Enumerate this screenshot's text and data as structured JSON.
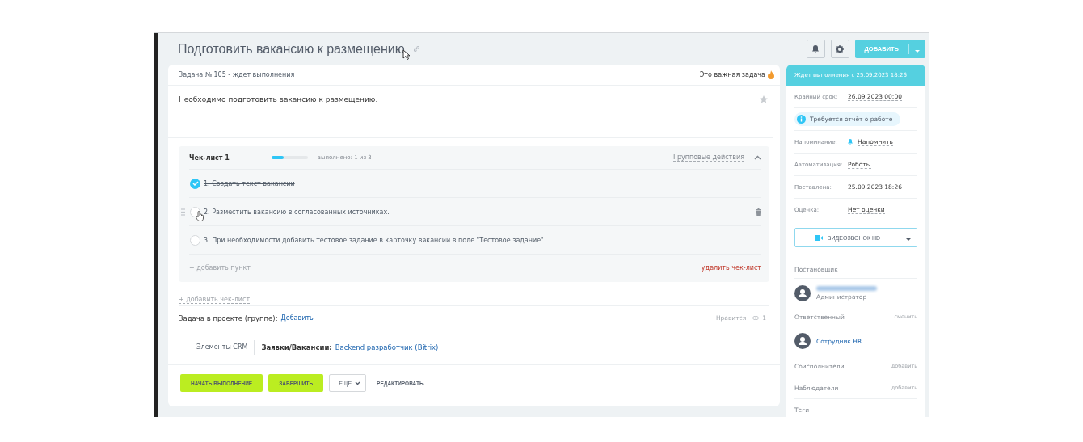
{
  "title": "Подготовить вакансию к размещению",
  "header": {
    "add_button": "ДОБАВИТЬ"
  },
  "task": {
    "status_line": "Задача № 105 - ждет выполнения",
    "important": "Это важная задача",
    "description": "Необходимо подготовить вакансию к размещению.",
    "favorite": false
  },
  "checklist": {
    "title": "Чек-лист 1",
    "level": 0.33,
    "progress_text": "выполнено: 1 из 3",
    "group_actions": "Групповые действия",
    "expanded": true,
    "items": [
      {
        "text": "1. Создать текст вакансии",
        "checked": true,
        "hovered": false
      },
      {
        "text": "2. Разместить вакансию в согласованных источниках.",
        "checked": false,
        "hovered": true
      },
      {
        "text": "3. При необходимости добавить тестовое задание в карточку вакансии в поле \"Тестовое задание\"",
        "checked": false,
        "hovered": false
      }
    ],
    "add_item": "+ добавить пункт",
    "delete": "удалить чек-лист"
  },
  "add_checklist": "+ добавить чек-лист",
  "project": {
    "label": "Задача в проекте (группе):",
    "link": "Добавить",
    "like": "Нравится",
    "views": "1"
  },
  "crm": {
    "label": "Элементы CRM",
    "type": "Заявки/Вакансии:",
    "link": "Backend разработчик (Bitrix)"
  },
  "actions": {
    "start": "НАЧАТЬ ВЫПОЛНЕНИЕ",
    "finish": "ЗАВЕРШИТЬ",
    "more": "ЕЩЁ",
    "edit": "РЕДАКТИРОВАТЬ"
  },
  "sidebar": {
    "status": "Ждет выполнения с 25.09.2023 18:26",
    "fields": [
      {
        "kind": "value",
        "label": "Крайний срок:",
        "value": "26.09.2023 00:00"
      },
      {
        "kind": "notice",
        "value": "Требуется отчёт о работе"
      },
      {
        "kind": "reminder",
        "label": "Напоминание:",
        "value": "Напомнить"
      },
      {
        "kind": "value",
        "label": "Автоматизация:",
        "value": "Роботы"
      },
      {
        "kind": "plain",
        "label": "Поставлена:",
        "value": "25.09.2023 18:26"
      },
      {
        "kind": "value",
        "label": "Оценка:",
        "value": "Нет оценки"
      }
    ],
    "video_button": "ВИДЕОЗВОНОК HD",
    "creator": {
      "label": "Постановщик",
      "role": "Администратор"
    },
    "responsible": {
      "label": "Ответственный",
      "action": "сменить",
      "name": "Сотрудник HR"
    },
    "sections": [
      {
        "label": "Соисполнители",
        "action": "добавить"
      },
      {
        "label": "Наблюдатели",
        "action": "добавить"
      },
      {
        "label": "Теги"
      }
    ]
  }
}
